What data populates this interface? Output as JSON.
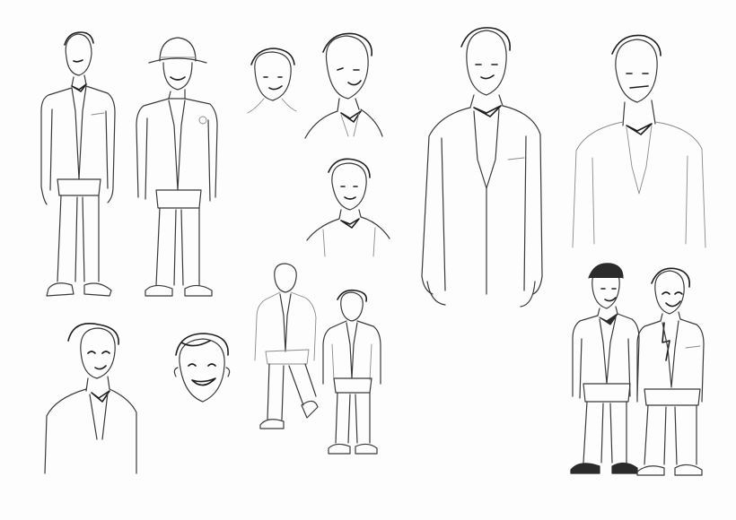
{
  "sheet": {
    "background": "#fdfdfd",
    "ink_color": "#3a3a3a",
    "sketches": [
      {
        "name": "standing-man-bowtie-full-body"
      },
      {
        "name": "standing-man-fedora-full-body"
      },
      {
        "name": "head-study-three-quarter"
      },
      {
        "name": "head-and-bowtie-bust-study"
      },
      {
        "name": "small-bust-study-bowtie"
      },
      {
        "name": "large-suit-torso-study"
      },
      {
        "name": "suit-torso-light-sketch"
      },
      {
        "name": "bust-study-lower-left"
      },
      {
        "name": "smiling-face-study"
      },
      {
        "name": "walking-figure-sketch"
      },
      {
        "name": "standing-figure-hands-in-pockets"
      },
      {
        "name": "two-men-in-suits-pair"
      }
    ]
  }
}
